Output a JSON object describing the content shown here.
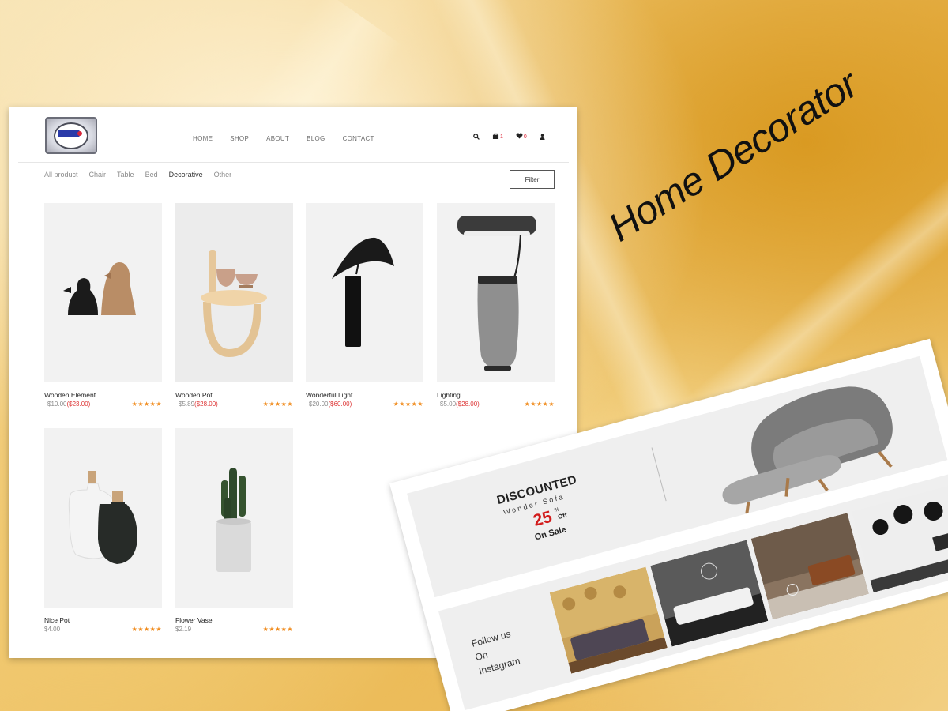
{
  "header": {
    "nav": [
      "HOME",
      "SHOP",
      "ABOUT",
      "BLOG",
      "CONTACT"
    ],
    "cart_count": "1",
    "wishlist_count": "0",
    "icons": [
      "search-icon",
      "cart-icon",
      "heart-icon",
      "user-icon"
    ]
  },
  "categories": {
    "items": [
      "All product",
      "Chair",
      "Table",
      "Bed",
      "Decorative",
      "Other"
    ],
    "active": "Decorative"
  },
  "filter_label": "Filter",
  "products": [
    {
      "name": "Wooden Element",
      "price": "$10.00",
      "old_price": "($23.00)",
      "stars": "★★★★★"
    },
    {
      "name": "Wooden Pot",
      "price": "$5.89",
      "old_price": "($28.00)",
      "stars": "★★★★★"
    },
    {
      "name": "Wonderful Light",
      "price": "$20.00",
      "old_price": "($60.00)",
      "stars": "★★★★★"
    },
    {
      "name": "Lighting",
      "price": "$5.00",
      "old_price": "($28.00)",
      "stars": "★★★★★"
    },
    {
      "name": "Nice Pot",
      "price": "$4.00",
      "old_price": "",
      "stars": "★★★★★"
    },
    {
      "name": "Flower Vase",
      "price": "$2.19",
      "old_price": "",
      "stars": "★★★★★"
    }
  ],
  "promo": {
    "title": "DISCOUNTED",
    "subtitle": "Wonder Sofa",
    "percent": "25",
    "percent_symbol": "%",
    "off": "Off",
    "on_sale": "On Sale"
  },
  "instagram": {
    "line1": "Follow us",
    "line2": "On",
    "line3": "Instagram"
  },
  "hero_title": "Home Decorator",
  "colors": {
    "star": "#f08a1a",
    "old_price": "#d33333",
    "discount": "#d21c1c"
  }
}
